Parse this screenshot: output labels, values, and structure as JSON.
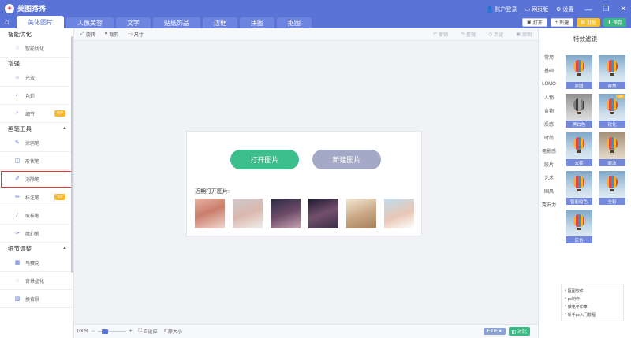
{
  "app": {
    "title": "美图秀秀"
  },
  "titlebar_links": {
    "account": "账户登录",
    "web": "网页版",
    "settings": "设置"
  },
  "tabs": [
    "美化图片",
    "人像美容",
    "文字",
    "贴纸饰品",
    "边框",
    "拼图",
    "抠图"
  ],
  "actions": {
    "open": "打开",
    "new": "新建",
    "batch": "批处",
    "save": "保存"
  },
  "sidebar": {
    "sections": [
      {
        "title": "智能优化",
        "items": [
          {
            "label": "智能优化"
          }
        ]
      },
      {
        "title": "增强",
        "items": [
          {
            "label": "光效"
          },
          {
            "label": "色彩"
          },
          {
            "label": "细节",
            "vip": "VIP"
          }
        ]
      },
      {
        "title": "画笔工具",
        "items": [
          {
            "label": "涂鸦笔"
          },
          {
            "label": "形状笔"
          },
          {
            "label": "消除笔"
          },
          {
            "label": "标注笔",
            "vip": "VIP"
          },
          {
            "label": "取样笔"
          },
          {
            "label": "魔幻笔"
          }
        ]
      },
      {
        "title": "细节调整",
        "items": [
          {
            "label": "马赛克"
          },
          {
            "label": "背景虚化"
          },
          {
            "label": "换背景"
          }
        ]
      }
    ]
  },
  "toolbar": {
    "rotate": "旋转",
    "crop": "裁剪",
    "size": "尺寸",
    "undo": "撤销",
    "redo": "重做",
    "history": "历史",
    "original": "原图"
  },
  "canvas": {
    "open_btn": "打开图片",
    "new_btn": "新建图片",
    "recent_label": "近期打开图片:"
  },
  "status": {
    "zoom": "100%",
    "fit": "自适应",
    "actual": "原大小",
    "exif": "EXIF",
    "compare": "对比"
  },
  "filters": {
    "title": "特效滤镜",
    "categories": [
      "常用",
      "基础",
      "LOMO",
      "人物",
      "食物",
      "质感",
      "时尚",
      "电影感",
      "胶片",
      "艺术",
      "国风",
      "冤友力"
    ],
    "thumbs": [
      {
        "label": "原图",
        "style": ""
      },
      {
        "label": "自然",
        "style": ""
      },
      {
        "label": "黑白色",
        "style": "bw"
      },
      {
        "label": "锐化",
        "style": "",
        "vip": "VIP"
      },
      {
        "label": "去雾",
        "style": ""
      },
      {
        "label": "暖波",
        "style": "warm"
      },
      {
        "label": "智能绘色",
        "style": ""
      },
      {
        "label": "全彩",
        "style": ""
      },
      {
        "label": "反色",
        "style": ""
      }
    ],
    "links": [
      "抠图软件",
      "ps制作",
      "做电子印章",
      "新手ps入门教程"
    ]
  }
}
